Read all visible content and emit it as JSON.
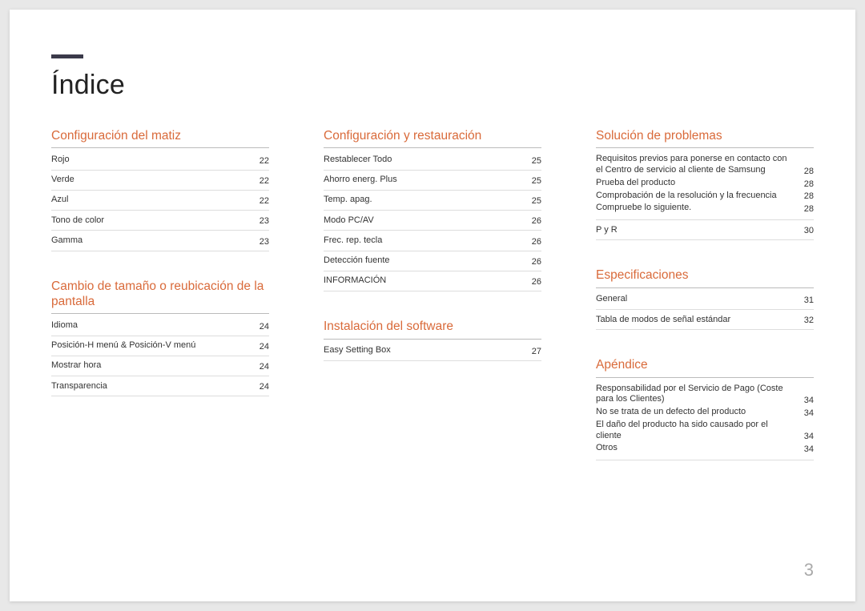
{
  "title": "Índice",
  "page_number": "3",
  "columns": [
    {
      "sections": [
        {
          "heading": "Configuración del matiz",
          "entries": [
            {
              "label": "Rojo",
              "page": "22"
            },
            {
              "label": "Verde",
              "page": "22"
            },
            {
              "label": "Azul",
              "page": "22"
            },
            {
              "label": "Tono de color",
              "page": "23"
            },
            {
              "label": "Gamma",
              "page": "23"
            }
          ]
        },
        {
          "heading": "Cambio de tamaño o reubicación de la pantalla",
          "entries": [
            {
              "label": "Idioma",
              "page": "24"
            },
            {
              "label": "Posición-H menú & Posición-V menú",
              "page": "24"
            },
            {
              "label": "Mostrar hora",
              "page": "24"
            },
            {
              "label": "Transparencia",
              "page": "24"
            }
          ]
        }
      ]
    },
    {
      "sections": [
        {
          "heading": "Configuración y restauración",
          "entries": [
            {
              "label": "Restablecer Todo",
              "page": "25"
            },
            {
              "label": "Ahorro energ. Plus",
              "page": "25"
            },
            {
              "label": "Temp. apag.",
              "page": "25"
            },
            {
              "label": "Modo PC/AV",
              "page": "26"
            },
            {
              "label": "Frec. rep. tecla",
              "page": "26"
            },
            {
              "label": "Detección fuente",
              "page": "26"
            },
            {
              "label": "INFORMACIÓN",
              "page": "26"
            }
          ]
        },
        {
          "heading": "Instalación del software",
          "entries": [
            {
              "label": "Easy Setting Box",
              "page": "27"
            }
          ]
        }
      ]
    },
    {
      "sections": [
        {
          "heading": "Solución de problemas",
          "entry_groups": [
            {
              "sub": [
                {
                  "label": "Requisitos previos para ponerse en contacto con el Centro de servicio al cliente de Samsung",
                  "page": "28"
                },
                {
                  "label": "Prueba del producto",
                  "page": "28"
                },
                {
                  "label": "Comprobación de la resolución y la frecuencia",
                  "page": "28"
                },
                {
                  "label": "Compruebe lo siguiente.",
                  "page": "28"
                }
              ]
            }
          ],
          "entries": [
            {
              "label": "P y R",
              "page": "30"
            }
          ]
        },
        {
          "heading": "Especificaciones",
          "entries": [
            {
              "label": "General",
              "page": "31"
            },
            {
              "label": "Tabla de modos de señal estándar",
              "page": "32"
            }
          ]
        },
        {
          "heading": "Apéndice",
          "entry_groups": [
            {
              "sub": [
                {
                  "label": "Responsabilidad por el Servicio de Pago (Coste para los Clientes)",
                  "page": "34"
                },
                {
                  "label": "No se trata de un defecto del producto",
                  "page": "34"
                },
                {
                  "label": "El daño del producto ha sido causado por el cliente",
                  "page": "34"
                },
                {
                  "label": "Otros",
                  "page": "34"
                }
              ]
            }
          ]
        }
      ]
    }
  ]
}
